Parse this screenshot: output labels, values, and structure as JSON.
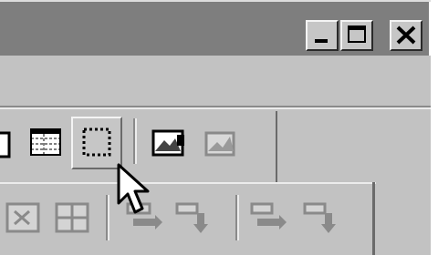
{
  "window": {
    "title_buttons": [
      {
        "name": "minimize-icon",
        "glyph": "_"
      },
      {
        "name": "maximize-icon",
        "glyph": "□"
      },
      {
        "name": "close-icon",
        "glyph": "×"
      }
    ],
    "doc_buttons": [
      {
        "name": "minimize-icon",
        "glyph": "_"
      },
      {
        "name": "restore-icon",
        "glyph": "❐"
      },
      {
        "name": "close-icon",
        "glyph": "×"
      }
    ]
  },
  "toolbar": {
    "row1": [
      {
        "icon": "format-icon"
      },
      {
        "icon": "table-icon"
      },
      {
        "icon": "select-frame-icon",
        "pressed": true
      },
      {
        "icon": "insert-picture-icon"
      },
      {
        "icon": "picture-disabled-icon"
      }
    ],
    "row2": [
      {
        "icon": "merge-cells-icon"
      },
      {
        "icon": "split-cells-icon"
      },
      {
        "icon": "insert-row-above-icon"
      },
      {
        "icon": "insert-row-below-icon"
      },
      {
        "icon": "delete-row-icon"
      },
      {
        "icon": "delete-column-icon"
      }
    ]
  },
  "colors": {
    "face": "#c2c2c2",
    "titlebar": "#7e7e7e",
    "shadow": "#6a6a6a",
    "highlight": "#f4f4f4"
  }
}
